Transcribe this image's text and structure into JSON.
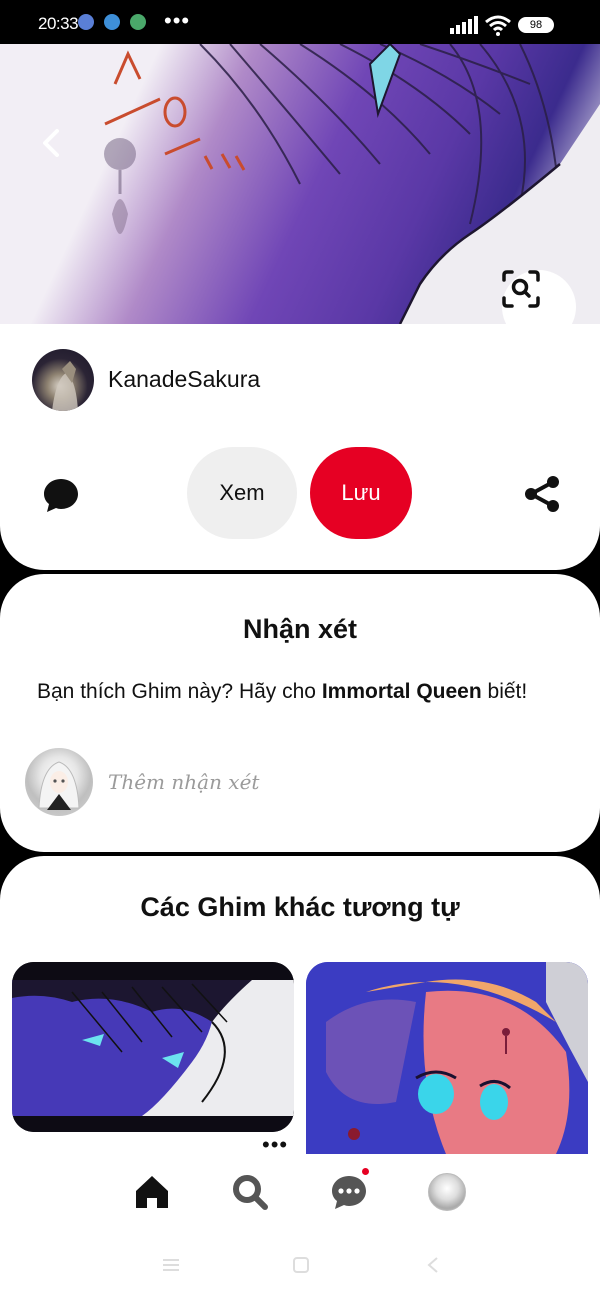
{
  "status_bar": {
    "time": "20:33",
    "more": "•••",
    "battery": "98"
  },
  "pin": {
    "author": "KanadeSakura",
    "view_label": "Xem",
    "save_label": "Lưu"
  },
  "comments": {
    "title": "Nhận xét",
    "prompt_prefix": "Bạn thích Ghim này? Hãy cho ",
    "prompt_name": "Immortal Queen",
    "prompt_suffix": " biết!",
    "placeholder": "Thêm nhận xét"
  },
  "related": {
    "title": "Các Ghim khác tương tự",
    "more_label": "•••"
  },
  "colors": {
    "brand_red": "#e60023",
    "button_gray": "#efefef",
    "text": "#111111",
    "placeholder": "#9b9b9b"
  },
  "icons": {
    "back": "chevron-left-icon",
    "lens": "visual-search-icon",
    "comment": "speech-bubble-icon",
    "share": "share-icon",
    "home": "home-icon",
    "search": "search-icon",
    "messages": "chat-icon"
  }
}
